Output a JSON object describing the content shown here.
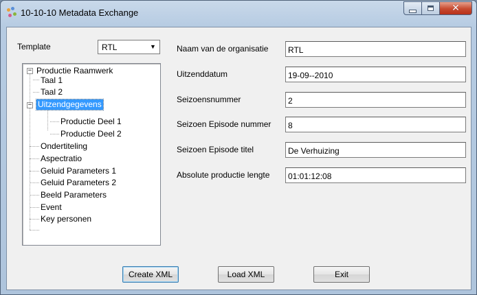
{
  "window": {
    "title": "10-10-10 Metadata Exchange",
    "close_glyph": "✕"
  },
  "template": {
    "label": "Template",
    "selected": "RTL",
    "arrow": "▼"
  },
  "tree": {
    "root": "Productie Raamwerk",
    "items": [
      "Taal 1",
      "Taal 2",
      "Uitzendgegevens",
      "Productie Deel 1",
      "Productie Deel 2",
      "Ondertiteling",
      "Aspectratio",
      "Geluid Parameters 1",
      "Geluid Parameters 2",
      "Beeld Parameters",
      "Event",
      "Key personen"
    ],
    "selected": "Uitzendgegevens",
    "collapse_glyph": "−"
  },
  "form": {
    "fields": [
      {
        "label": "Naam van de organisatie",
        "value": "RTL"
      },
      {
        "label": "Uitzenddatum",
        "value": "19-09--2010"
      },
      {
        "label": "Seizoensnummer",
        "value": "2"
      },
      {
        "label": "Seizoen Episode nummer",
        "value": "8"
      },
      {
        "label": "Seizoen Episode titel",
        "value": "De Verhuizing"
      },
      {
        "label": "Absolute productie lengte",
        "value": "01:01:12:08"
      }
    ]
  },
  "buttons": {
    "create": "Create XML",
    "load": "Load XML",
    "exit": "Exit"
  }
}
